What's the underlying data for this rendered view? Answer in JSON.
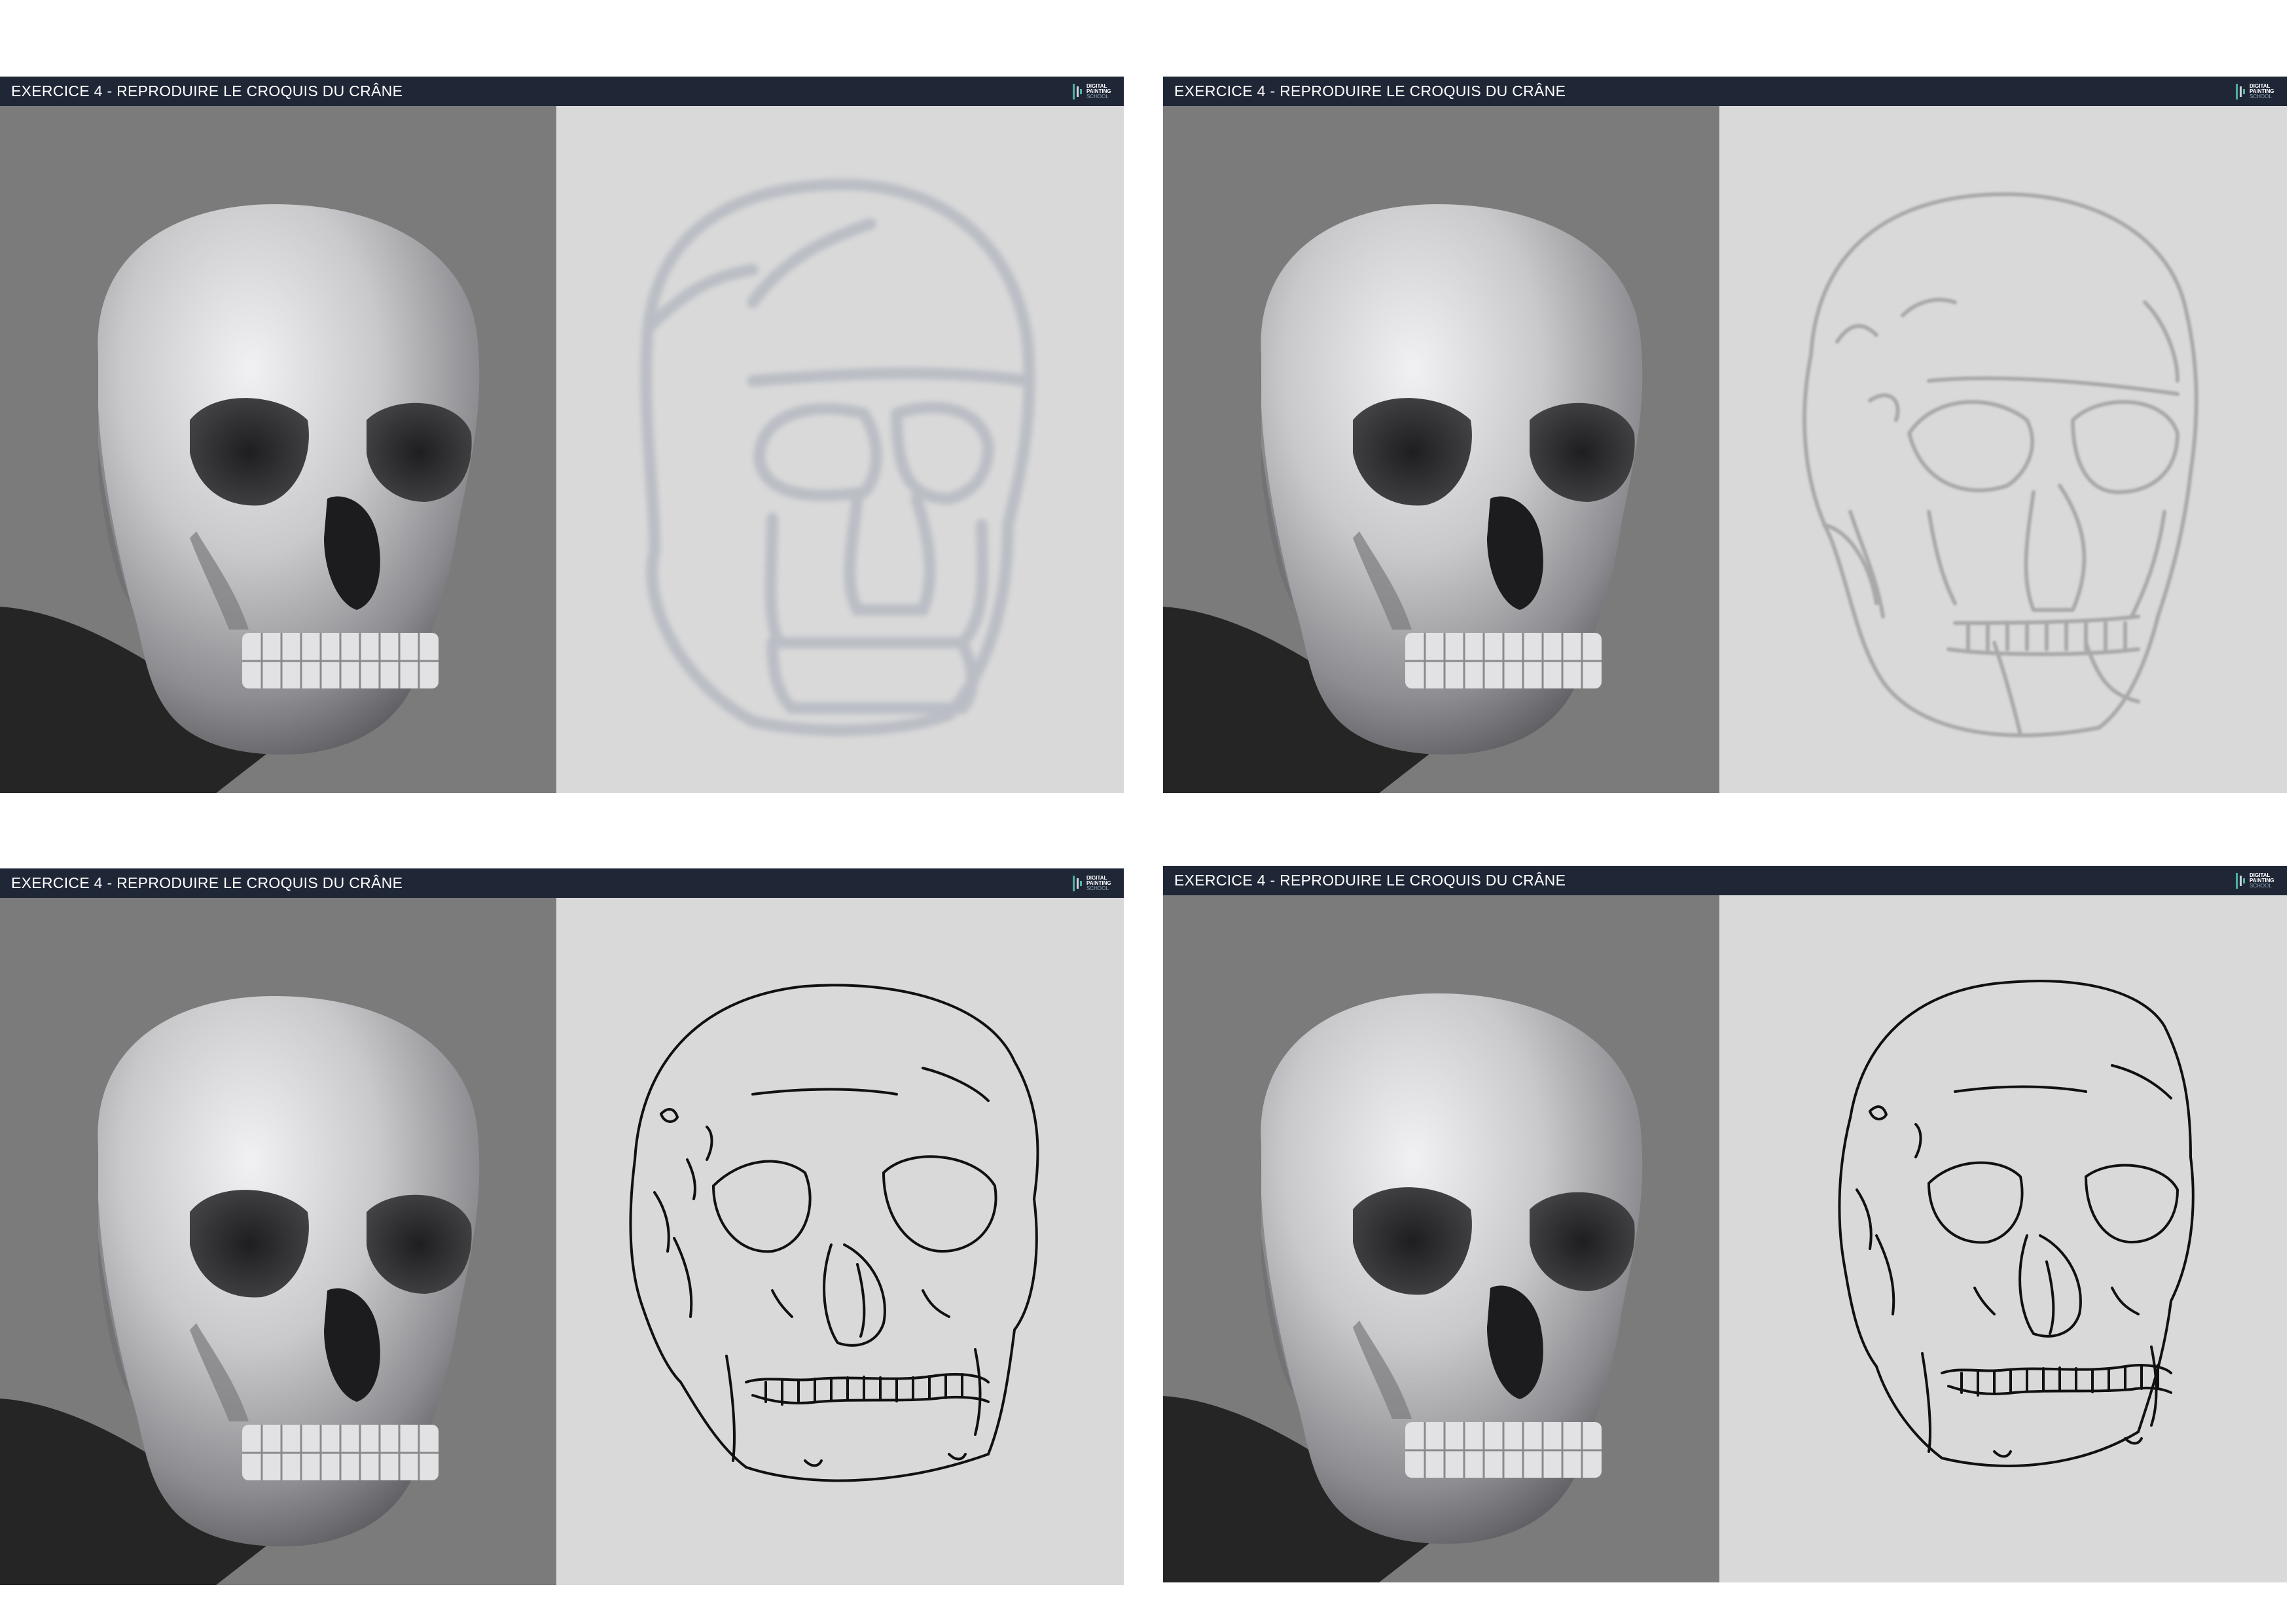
{
  "colors": {
    "header_bg": "#1f2737",
    "photo_bg": "#7b7b7b",
    "sketch_bg": "#d9d9d9",
    "shadow": "#252525",
    "sketch_soft": "#b7bbc3",
    "sketch_gray": "#a9a9a9",
    "sketch_ink": "#111111"
  },
  "logo": {
    "line1": "DIGITAL",
    "line2": "PAINTING",
    "line3": "SCHOOL",
    "icon": "dp-logo-icon"
  },
  "panels": [
    {
      "title": "EXERCICE 4 - REPRODUIRE LE CROQUIS DU CRÂNE",
      "stage": "rough"
    },
    {
      "title": "EXERCICE 4 - REPRODUIRE LE CROQUIS DU CRÂNE",
      "stage": "construction"
    },
    {
      "title": "EXERCICE 4 - REPRODUIRE LE CROQUIS DU CRÂNE",
      "stage": "lineart"
    },
    {
      "title": "EXERCICE 4 - REPRODUIRE LE CROQUIS DU CRÂNE",
      "stage": "final"
    }
  ]
}
